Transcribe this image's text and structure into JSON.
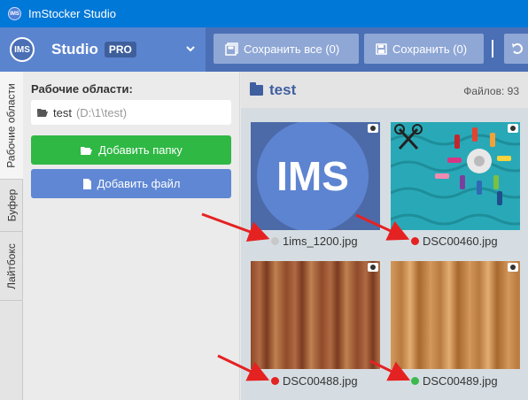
{
  "titlebar": {
    "app_icon_text": "IMS",
    "title": "ImStocker Studio"
  },
  "header": {
    "logo_text": "IMS",
    "studio_label": "Studio",
    "pro_badge": "PRO",
    "save_all_label": "Сохранить все (0)",
    "save_label": "Сохранить (0)"
  },
  "tabs": [
    {
      "label": "Рабочие области",
      "active": true
    },
    {
      "label": "Буфер",
      "active": false
    },
    {
      "label": "Лайтбокс",
      "active": false
    }
  ],
  "left_panel": {
    "workspaces_title": "Рабочие области:",
    "workspace": {
      "name": "test",
      "path": "(D:\\1\\test)"
    },
    "add_folder_label": "Добавить папку",
    "add_file_label": "Добавить файл"
  },
  "main": {
    "folder_title": "test",
    "file_count": "Файлов: 93",
    "files": [
      {
        "name": "1ims_1200.jpg",
        "status_color": "#c8c8c8",
        "thumb_text": "IMS"
      },
      {
        "name": "DSC00460.jpg",
        "status_color": "#e52222"
      },
      {
        "name": "DSC00488.jpg",
        "status_color": "#e52222"
      },
      {
        "name": "DSC00489.jpg",
        "status_color": "#3cb94f"
      }
    ]
  },
  "colors": {
    "titlebar": "#0078d7",
    "header": "#4a6fb5",
    "accent_green": "#2fb844",
    "accent_blue": "#5f87d4",
    "annotation_arrow": "#e52222"
  }
}
